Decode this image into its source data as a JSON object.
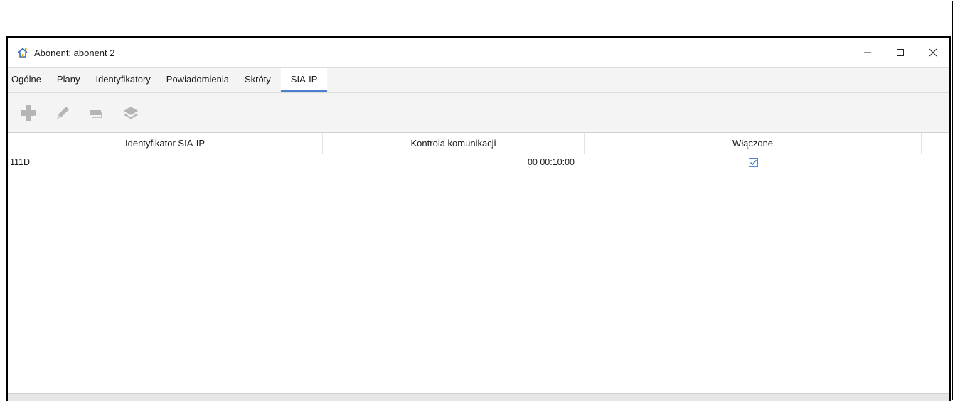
{
  "window": {
    "title": "Abonent: abonent 2",
    "app_icon": "home-icon",
    "controls": [
      "minimize-icon",
      "maximize-icon",
      "close-icon"
    ]
  },
  "tabs": [
    {
      "label": "Ogólne",
      "active": false
    },
    {
      "label": "Plany",
      "active": false
    },
    {
      "label": "Identyfikatory",
      "active": false
    },
    {
      "label": "Powiadomienia",
      "active": false
    },
    {
      "label": "Skróty",
      "active": false
    },
    {
      "label": "SIA-IP",
      "active": true
    }
  ],
  "toolbar": {
    "buttons": [
      {
        "icon": "add-icon",
        "enabled": false
      },
      {
        "icon": "edit-icon",
        "enabled": false
      },
      {
        "icon": "remove-icon",
        "enabled": false
      },
      {
        "icon": "layers-icon",
        "enabled": false
      }
    ]
  },
  "table": {
    "columns": [
      "Identyfikator SIA-IP",
      "Kontrola komunikacji",
      "Włączone"
    ],
    "rows": [
      {
        "id": "111D",
        "control": "00 00:10:00",
        "enabled": true
      }
    ]
  },
  "colors": {
    "accent": "#4a7fd0",
    "disabled_icon": "#b5b5b5",
    "tab_bar_bg": "#f4f4f4"
  }
}
